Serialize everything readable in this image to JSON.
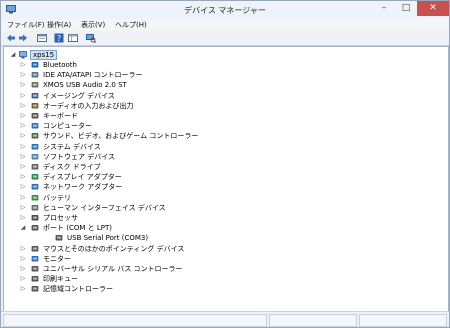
{
  "window": {
    "title": "デバイス マネージャー",
    "minimize": "–",
    "maximize": "□",
    "close": "✕"
  },
  "menu": [
    "ファイル(F)",
    "操作(A)",
    "表示(V)",
    "ヘルプ(H)"
  ],
  "toolbar": [
    "back-arrow-icon",
    "forward-arrow-icon",
    "properties-icon",
    "help-icon",
    "view-icon",
    "scan-hardware-icon"
  ],
  "tree": {
    "root": "xps15",
    "items": [
      {
        "label": "Bluetooth",
        "icon": "bluetooth-icon",
        "color": "#1a5fb4",
        "expander": "▷",
        "level": 1
      },
      {
        "label": "IDE ATA/ATAPI コントローラー",
        "icon": "ide-controller-icon",
        "color": "#5a6f8c",
        "expander": "▷",
        "level": 1
      },
      {
        "label": "XMOS USB Audio 2.0 ST",
        "icon": "audio-device-icon",
        "color": "#6b6b6b",
        "expander": "▷",
        "level": 1
      },
      {
        "label": "イメージング デバイス",
        "icon": "camera-icon",
        "color": "#3b5f8a",
        "expander": "▷",
        "level": 1
      },
      {
        "label": "オーディオの入力および出力",
        "icon": "speaker-icon",
        "color": "#7a5a2a",
        "expander": "▷",
        "level": 1
      },
      {
        "label": "キーボード",
        "icon": "keyboard-icon",
        "color": "#555555",
        "expander": "▷",
        "level": 1
      },
      {
        "label": "コンピューター",
        "icon": "computer-icon",
        "color": "#2f6db5",
        "expander": "▷",
        "level": 1
      },
      {
        "label": "サウンド、ビデオ、およびゲーム コントローラー",
        "icon": "sound-video-icon",
        "color": "#4a6f3a",
        "expander": "▷",
        "level": 1
      },
      {
        "label": "システム デバイス",
        "icon": "system-device-icon",
        "color": "#2f6db5",
        "expander": "▷",
        "level": 1
      },
      {
        "label": "ソフトウェア デバイス",
        "icon": "software-device-icon",
        "color": "#5a7fa8",
        "expander": "▷",
        "level": 1
      },
      {
        "label": "ディスク ドライブ",
        "icon": "disk-drive-icon",
        "color": "#606060",
        "expander": "▷",
        "level": 1
      },
      {
        "label": "ディスプレイ アダプター",
        "icon": "display-adapter-icon",
        "color": "#2a8a4a",
        "expander": "▷",
        "level": 1
      },
      {
        "label": "ネットワーク アダプター",
        "icon": "network-adapter-icon",
        "color": "#2f6db5",
        "expander": "▷",
        "level": 1
      },
      {
        "label": "バッテリ",
        "icon": "battery-icon",
        "color": "#3a8a3a",
        "expander": "▷",
        "level": 1
      },
      {
        "label": "ヒューマン インターフェイス デバイス",
        "icon": "hid-icon",
        "color": "#6a6a6a",
        "expander": "▷",
        "level": 1
      },
      {
        "label": "プロセッサ",
        "icon": "processor-icon",
        "color": "#4a4a4a",
        "expander": "▷",
        "level": 1
      },
      {
        "label": "ポート (COM と LPT)",
        "icon": "port-icon",
        "color": "#555555",
        "expander": "◢",
        "level": 1
      },
      {
        "label": "USB Serial Port (COM3)",
        "icon": "serial-port-icon",
        "color": "#555555",
        "expander": "",
        "level": 2
      },
      {
        "label": "マウスとそのほかのポインティング デバイス",
        "icon": "mouse-icon",
        "color": "#555555",
        "expander": "▷",
        "level": 1
      },
      {
        "label": "モニター",
        "icon": "monitor-icon",
        "color": "#2f6db5",
        "expander": "▷",
        "level": 1
      },
      {
        "label": "ユニバーサル シリアル バス コントローラー",
        "icon": "usb-controller-icon",
        "color": "#555555",
        "expander": "▷",
        "level": 1
      },
      {
        "label": "印刷キュー",
        "icon": "printer-icon",
        "color": "#555555",
        "expander": "▷",
        "level": 1
      },
      {
        "label": "記憶域コントローラー",
        "icon": "storage-controller-icon",
        "color": "#555555",
        "expander": "▷",
        "level": 1
      }
    ]
  }
}
